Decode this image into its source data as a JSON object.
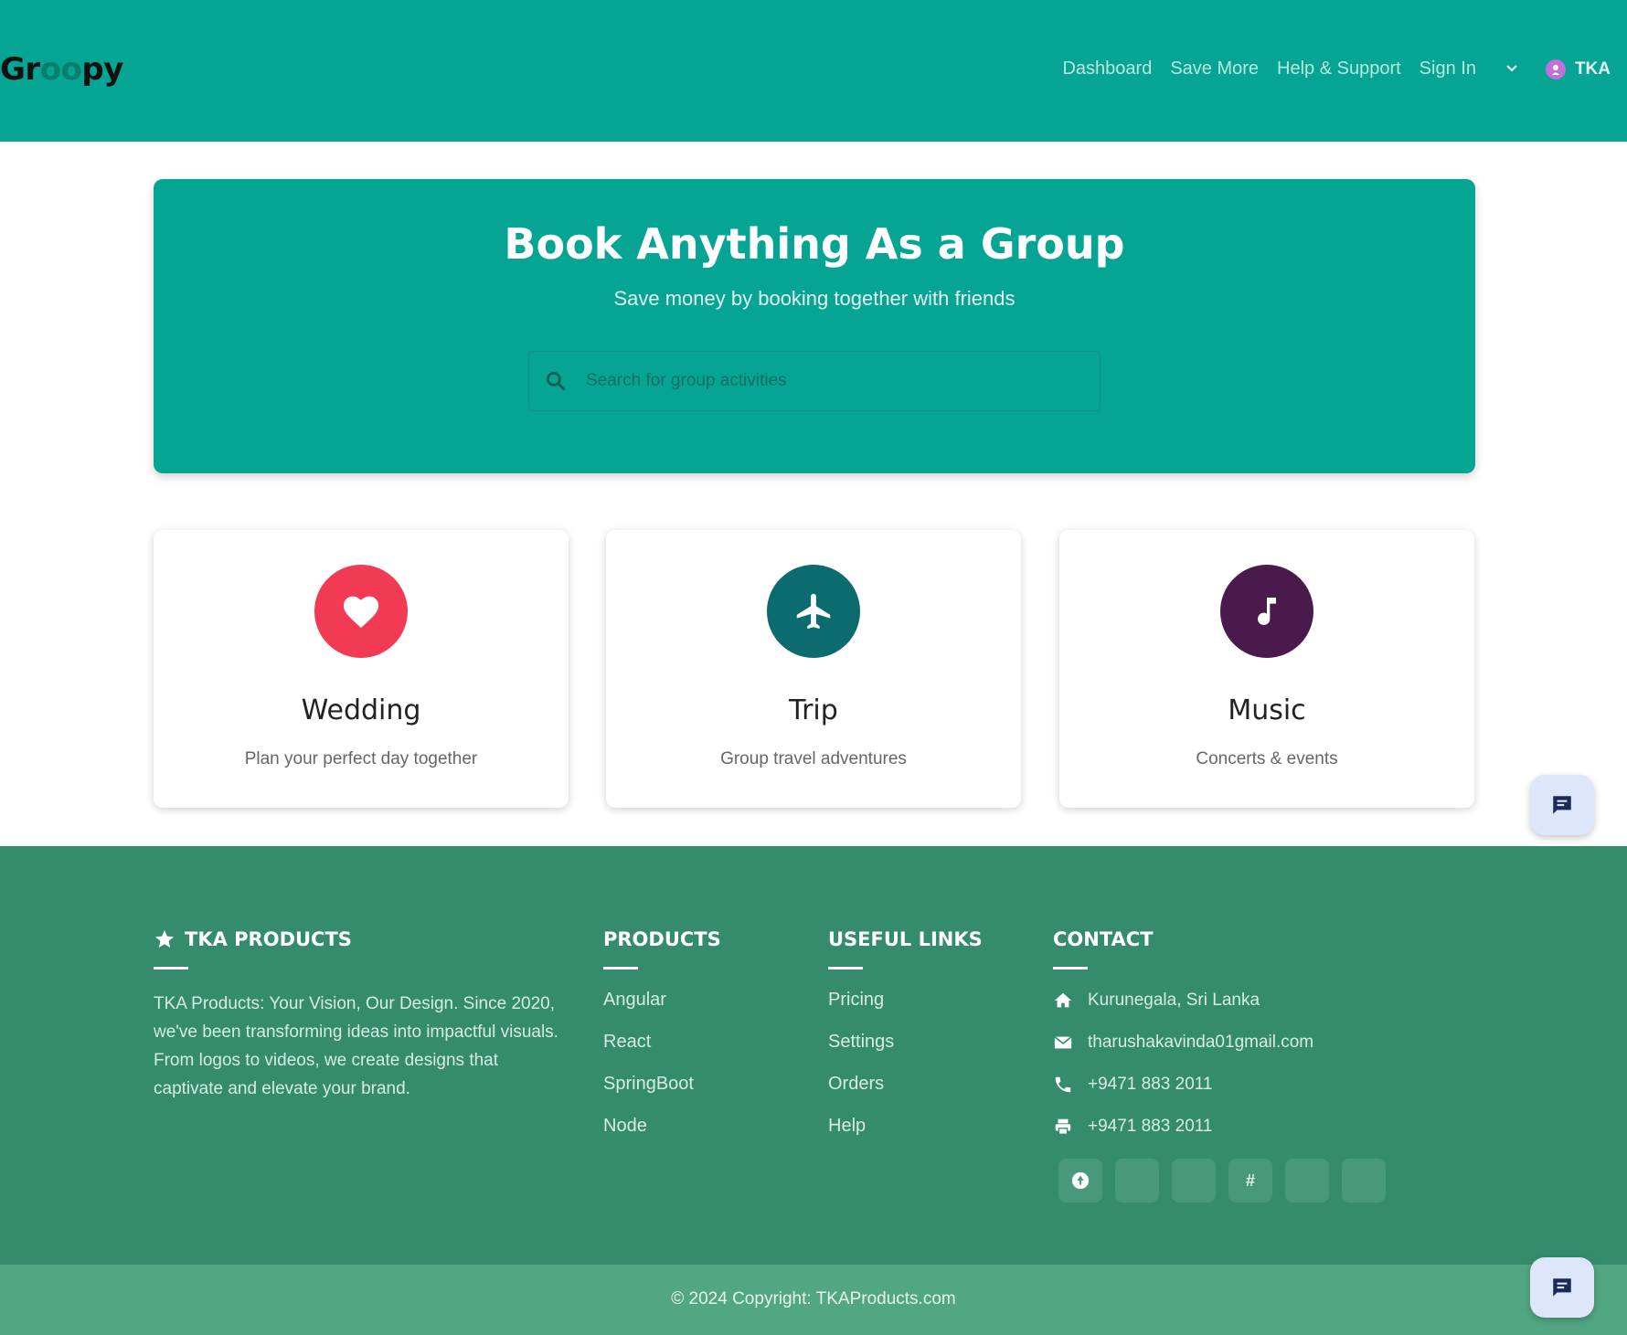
{
  "header": {
    "logo": {
      "part1": "Gr",
      "part2": "oo",
      "part3": "py"
    },
    "nav": [
      {
        "label": "Dashboard"
      },
      {
        "label": "Save More"
      },
      {
        "label": "Help & Support"
      },
      {
        "label": "Sign In"
      }
    ],
    "user_label": "TKA",
    "colors": {
      "bar": "#05a493",
      "avatar": "#c070d8"
    }
  },
  "hero": {
    "title": "Book Anything As a Group",
    "subtitle": "Save money by booking together with friends",
    "search_placeholder": "Search for group activities",
    "search_icon": "search-icon"
  },
  "categories": [
    {
      "title": "Wedding",
      "description": "Plan your perfect day together",
      "icon": "heart-icon",
      "color": "#f23a55"
    },
    {
      "title": "Trip",
      "description": "Group travel adventures",
      "icon": "airplane-icon",
      "color": "#0b6b6e"
    },
    {
      "title": "Music",
      "description": "Concerts & events",
      "icon": "music-note-icon",
      "color": "#4a1a4c"
    }
  ],
  "footer": {
    "brand_heading": "TKA PRODUCTS",
    "about": "TKA Products: Your Vision, Our Design. Since 2020, we've been transforming ideas into impactful visuals. From logos to videos, we create designs that captivate and elevate your brand.",
    "products": {
      "heading": "PRODUCTS",
      "links": [
        "Angular",
        "React",
        "SpringBoot",
        "Node"
      ]
    },
    "useful_links": {
      "heading": "USEFUL LINKS",
      "links": [
        "Pricing",
        "Settings",
        "Orders",
        "Help"
      ]
    },
    "contact": {
      "heading": "CONTACT",
      "address": "Kurunegala, Sri Lanka",
      "email": "tharushakavinda01gmail.com",
      "phone": "+9471 883 2011",
      "fax": "+9471 883 2011"
    },
    "socials": [
      {
        "icon": "github-icon",
        "glyph": ""
      },
      {
        "icon": "social-icon",
        "glyph": ""
      },
      {
        "icon": "social-icon",
        "glyph": ""
      },
      {
        "icon": "hashtag-icon",
        "glyph": "#"
      },
      {
        "icon": "social-icon",
        "glyph": ""
      },
      {
        "icon": "social-icon",
        "glyph": ""
      }
    ],
    "copyright": "© 2024 Copyright: TKAProducts.com",
    "colors": {
      "footer": "#358c6d",
      "bottom_bar": "#52a783"
    }
  },
  "chat_button_icon": "chat-icon"
}
